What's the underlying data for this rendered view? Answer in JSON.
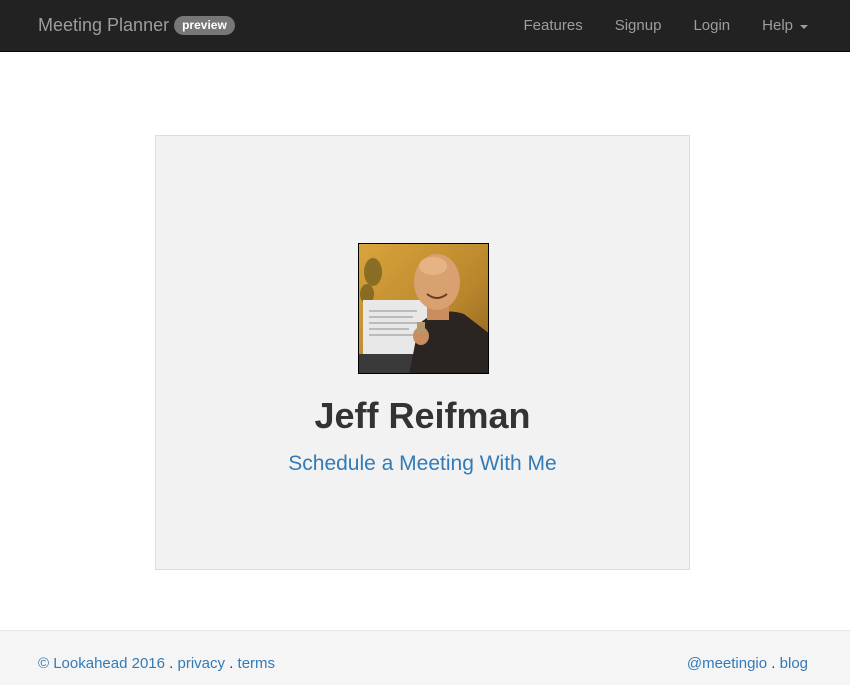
{
  "navbar": {
    "brand": "Meeting Planner",
    "badge": "preview",
    "items": [
      {
        "label": "Features"
      },
      {
        "label": "Signup"
      },
      {
        "label": "Login"
      },
      {
        "label": "Help"
      }
    ]
  },
  "profile": {
    "name": "Jeff Reifman",
    "schedule_link": "Schedule a Meeting With Me"
  },
  "footer": {
    "copyright": "© Lookahead 2016",
    "privacy": "privacy",
    "terms": "terms",
    "twitter": "@meetingio",
    "blog": "blog",
    "separator": "."
  }
}
